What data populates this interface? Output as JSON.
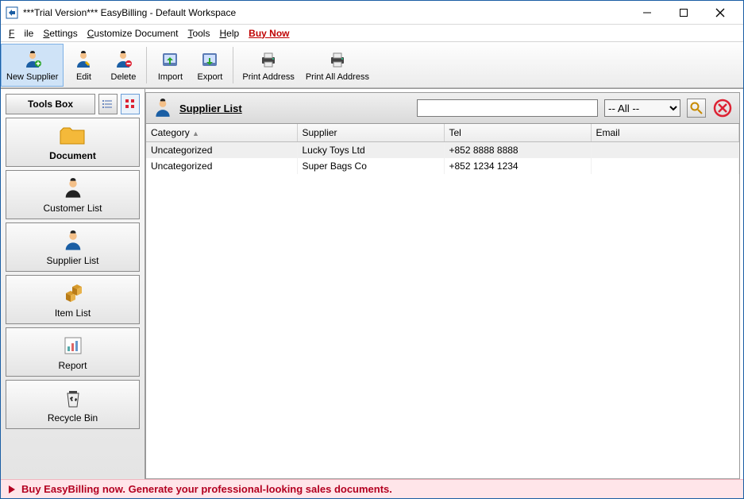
{
  "window": {
    "title": "***Trial Version*** EasyBilling - Default Workspace"
  },
  "menu": {
    "file": "File",
    "settings": "Settings",
    "customize": "Customize Document",
    "tools": "Tools",
    "help": "Help",
    "buy_now": "Buy Now"
  },
  "toolbar": {
    "new_supplier": "New Supplier",
    "edit": "Edit",
    "delete": "Delete",
    "import": "Import",
    "export": "Export",
    "print_address": "Print Address",
    "print_all_address": "Print All Address"
  },
  "toolbox": {
    "header": "Tools Box",
    "items": [
      {
        "label": "Document"
      },
      {
        "label": "Customer List"
      },
      {
        "label": "Supplier List"
      },
      {
        "label": "Item List"
      },
      {
        "label": "Report"
      },
      {
        "label": "Recycle Bin"
      }
    ]
  },
  "list": {
    "header_title": "Supplier List",
    "search_value": "",
    "filter_all": "-- All --",
    "columns": {
      "category": "Category",
      "supplier": "Supplier",
      "tel": "Tel",
      "email": "Email"
    },
    "rows": [
      {
        "category": "Uncategorized",
        "supplier": "Lucky Toys Ltd",
        "tel": "+852 8888 8888",
        "email": ""
      },
      {
        "category": "Uncategorized",
        "supplier": "Super Bags Co",
        "tel": "+852 1234 1234",
        "email": ""
      }
    ]
  },
  "promo": {
    "text": "Buy EasyBilling now. Generate your professional-looking sales documents."
  }
}
